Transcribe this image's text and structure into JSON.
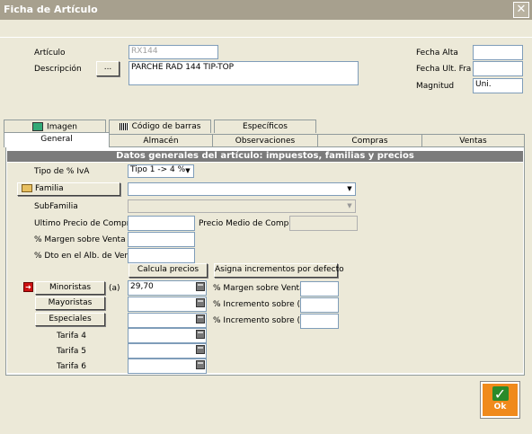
{
  "window": {
    "title": "Ficha de Artículo",
    "close_glyph": "✕"
  },
  "header": {
    "articulo_label": "Artículo",
    "articulo_value": "RX144",
    "descripcion_label": "Descripción",
    "descripcion_button": "...",
    "descripcion_value": "PARCHE RAD 144 TIP-TOP",
    "fecha_alta_label": "Fecha Alta",
    "fecha_alta_value": "",
    "fecha_ult_fra_label": "Fecha Ult. Fra",
    "fecha_ult_fra_value": "",
    "magnitud_label": "Magnitud",
    "magnitud_value": "Uni."
  },
  "tabs_top": [
    {
      "label": "Imagen",
      "icon": "image-icon"
    },
    {
      "label": "Código de barras",
      "icon": "barcode-icon"
    },
    {
      "label": "Específicos"
    }
  ],
  "tabs_bottom": [
    {
      "label": "General"
    },
    {
      "label": "Almacén"
    },
    {
      "label": "Observaciones"
    },
    {
      "label": "Compras"
    },
    {
      "label": "Ventas"
    }
  ],
  "general": {
    "section_title": "Datos generales del artículo: impuestos, familias y precios",
    "tipo_iva_label": "Tipo de % IvA",
    "tipo_iva_value": "Tipo 1 -> 4 %",
    "familia_button": "Familia",
    "familia_value": "",
    "subfamilia_label": "SubFamilia",
    "subfamilia_value": "",
    "ultimo_precio_label": "Ultimo Precio de Compra",
    "ultimo_precio_value": "",
    "precio_medio_label": "Precio Medio de Compra",
    "precio_medio_value": "",
    "margen_venta_label": "% Margen sobre Venta",
    "margen_venta_value": "",
    "dto_alb_label": "% Dto en el Alb. de Venta",
    "dto_alb_value": "",
    "calcula_button": "Calcula precios",
    "asigna_button": "Asigna incrementos por defecto",
    "tarifas": [
      {
        "label": "Minoristas",
        "suffix": "(a)",
        "value": "29,70",
        "pct_label": "%  Margen sobre Venta",
        "pct_value": ""
      },
      {
        "label": "Mayoristas",
        "suffix": "",
        "value": "",
        "pct_label": "%  Incremento sobre (a)",
        "pct_value": ""
      },
      {
        "label": "Especiales",
        "suffix": "",
        "value": "",
        "pct_label": "%  Incremento sobre (a)",
        "pct_value": ""
      },
      {
        "label": "Tarifa 4",
        "value": ""
      },
      {
        "label": "Tarifa 5",
        "value": ""
      },
      {
        "label": "Tarifa 6",
        "value": ""
      }
    ]
  },
  "ok_button": {
    "label": "Ok",
    "icon": "checkmark-icon"
  },
  "colors": {
    "accent_ok": "#f08a1c",
    "titlebar": "#a7a08e",
    "section_bar": "#7b7b7b"
  }
}
